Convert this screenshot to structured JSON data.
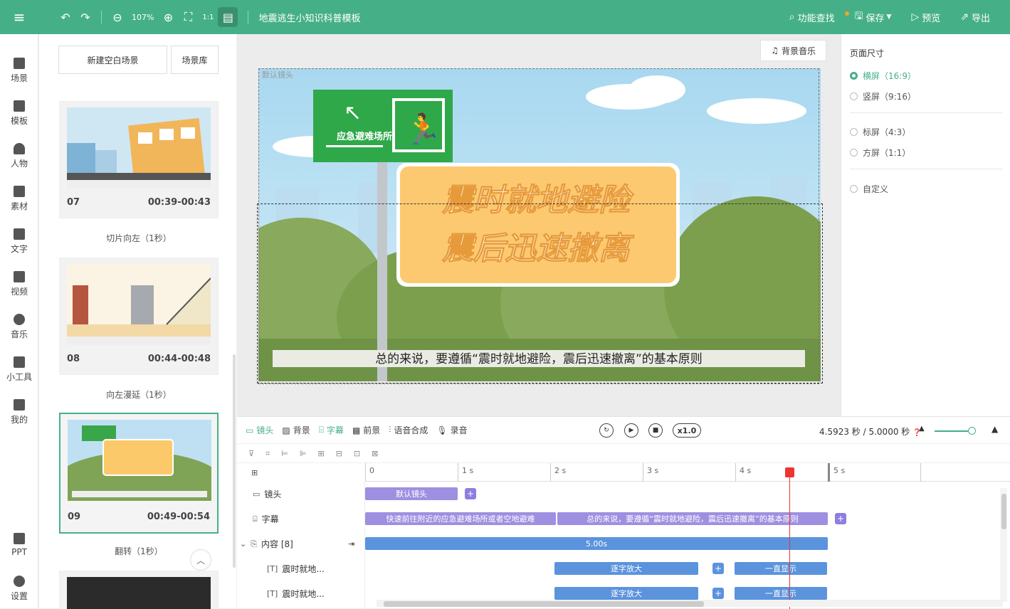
{
  "topbar": {
    "zoom": "107%",
    "title": "地震逃生小知识科普模板",
    "actions": {
      "find": "功能查找",
      "save": "保存",
      "preview": "预览",
      "export": "导出"
    }
  },
  "sidebar": {
    "items": [
      "场景",
      "模板",
      "人物",
      "素材",
      "文字",
      "视频",
      "音乐",
      "小工具",
      "我的",
      "PPT",
      "设置"
    ]
  },
  "scenes": {
    "new_blank": "新建空白场景",
    "library": "场景库",
    "cards": [
      {
        "num": "07",
        "time": "00:39-00:43",
        "transition": "切片向左（1秒）"
      },
      {
        "num": "08",
        "time": "00:44-00:48",
        "transition": "向左漫延（1秒）"
      },
      {
        "num": "09",
        "time": "00:49-00:54",
        "transition": "翻转（1秒）"
      }
    ]
  },
  "canvas": {
    "bgm": "背景音乐",
    "camera_label": "默认镜头",
    "sign_text": "应急避难场所",
    "headline1": "震时就地避险",
    "headline2": "震后迅速撤离",
    "subtitle": "总的来说，要遵循“震时就地避险，震后迅速撤离”的基本原则"
  },
  "page_size": {
    "title": "页面尺寸",
    "options": [
      {
        "label": "横屏（16:9）",
        "selected": true
      },
      {
        "label": "竖屏（9:16）",
        "selected": false
      },
      {
        "label": "标屏（4:3）",
        "selected": false
      },
      {
        "label": "方屏（1:1）",
        "selected": false
      },
      {
        "label": "自定义",
        "selected": false
      }
    ]
  },
  "timeline": {
    "tabs": [
      "镜头",
      "背景",
      "字幕",
      "前景",
      "语音合成",
      "录音"
    ],
    "speed": "x1.0",
    "time": "4.5923 秒 / 5.0000 秒",
    "ruler": [
      "0",
      "1 s",
      "2 s",
      "3 s",
      "4 s",
      "5 s"
    ],
    "rows": {
      "camera": "镜头",
      "subtitle": "字幕",
      "content": "内容 [8]",
      "item1": "震时就地...",
      "item2": "震时就地..."
    },
    "clips": {
      "camera": "默认镜头",
      "sub1": "快速前往附近的应急避难场所或者空地避难",
      "sub2": "总的来说，要遵循“震时就地避险，震后迅速撤离”的基本原则",
      "content": "5.00s",
      "zoom1": "逐字放大",
      "show1": "一直显示",
      "zoom2": "逐字放大",
      "show2": "一直显示"
    }
  }
}
